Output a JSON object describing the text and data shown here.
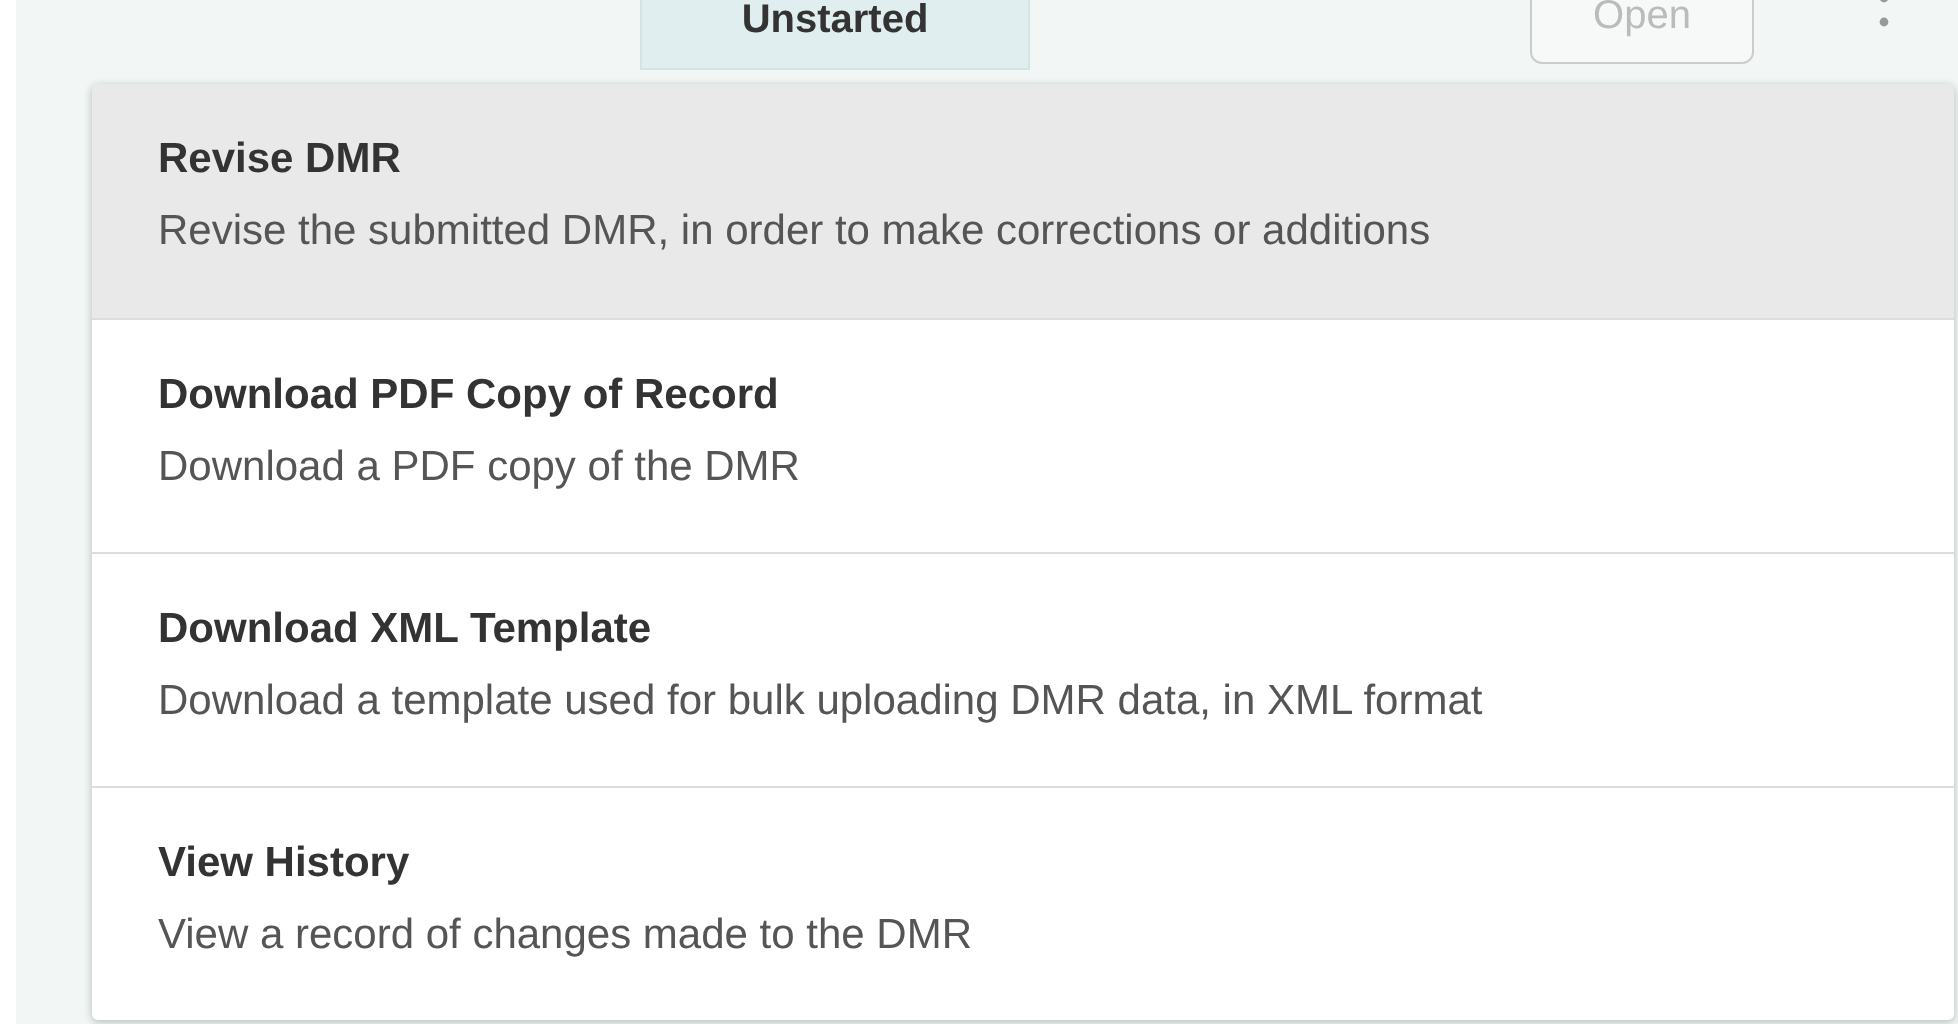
{
  "row": {
    "status": "Unstarted",
    "open_button": "Open"
  },
  "menu": {
    "items": [
      {
        "title": "Revise DMR",
        "description": "Revise the submitted DMR, in order to make corrections or additions",
        "selected": true
      },
      {
        "title": "Download PDF Copy of Record",
        "description": "Download a PDF copy of the DMR",
        "selected": false
      },
      {
        "title": "Download XML Template",
        "description": "Download a template used for bulk uploading DMR data, in XML format",
        "selected": false
      },
      {
        "title": "View History",
        "description": "View a record of changes made to the DMR",
        "selected": false
      }
    ]
  }
}
